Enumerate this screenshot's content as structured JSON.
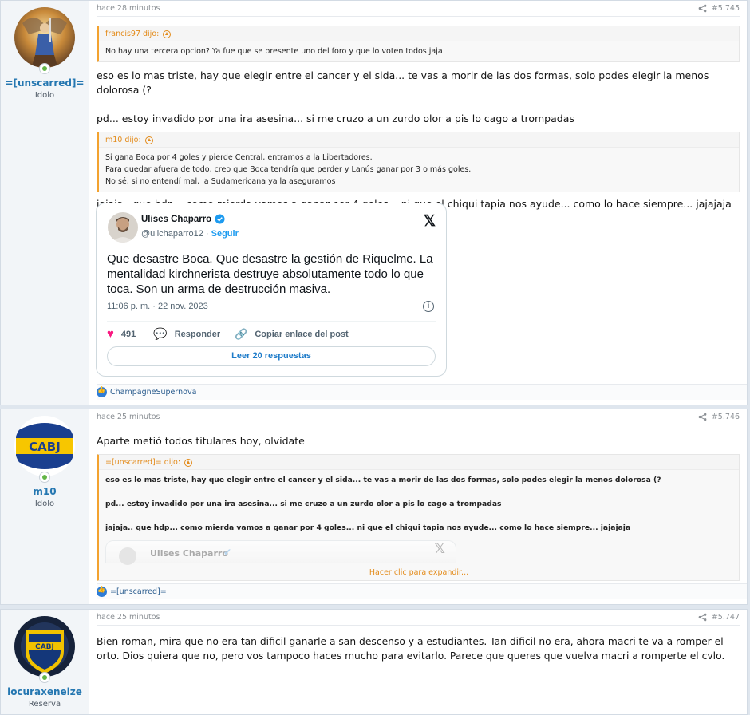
{
  "posts": [
    {
      "time": "hace 28 minutos",
      "number": "#5.745",
      "user": {
        "name": "=[unscarred]=",
        "title": "Idolo"
      },
      "quote1": {
        "author": "francis97 dijo:",
        "text": "No hay una tercera opcion? Ya fue que se presente uno del foro y que lo voten todos jaja"
      },
      "msg1": "eso es lo mas triste, hay que elegir entre el cancer y el sida... te vas a morir de las dos formas, solo podes elegir la menos dolorosa (?",
      "msg2": "pd... estoy invadido por una ira asesina... si me cruzo a un zurdo olor a pis lo cago a trompadas",
      "quote2": {
        "author": "m10 dijo:",
        "lines": [
          "Si gana Boca por 4 goles y pierde Central, entramos a la Libertadores.",
          "Para quedar afuera de todo, creo que Boca tendría que perder y Lanús ganar por 3 o más goles.",
          "No sé, si no entendí mal, la Sudamericana ya la aseguramos"
        ]
      },
      "msg3": "jajaja.. que hdp... como mierda vamos a ganar por 4 goles... ni que el chiqui tapia nos ayude... como lo hace siempre... jajajaja",
      "tweet": {
        "name": "Ulises Chaparro",
        "handle": "@ulichaparro12",
        "follow": "Seguir",
        "text": "Que desastre Boca. Que desastre la gestión de Riquelme. La mentalidad kirchnerista destruye absolutamente todo lo que toca. Son un arma de destrucción masiva.",
        "date": "11:06 p. m. · 22 nov. 2023",
        "likes": "491",
        "reply": "Responder",
        "copy": "Copiar enlace del post",
        "replies": "Leer 20 respuestas"
      },
      "reaction": "ChampagneSupernova"
    },
    {
      "time": "hace 25 minutos",
      "number": "#5.746",
      "user": {
        "name": "m10",
        "title": "Idolo"
      },
      "msg1": "Aparte metió todos titulares hoy, olvidate",
      "quote": {
        "author": "=[unscarred]= dijo:",
        "p1": "eso es lo mas triste, hay que elegir entre el cancer y el sida... te vas a morir de las dos formas, solo podes elegir la menos dolorosa (?",
        "p2": "pd... estoy invadido por una ira asesina... si me cruzo a un zurdo olor a pis lo cago a trompadas",
        "p3": "jajaja.. que hdp... como mierda vamos a ganar por 4 goles... ni que el chiqui tapia nos ayude... como lo hace siempre... jajajaja",
        "tweet_name": "Ulises Chaparro",
        "expand": "Hacer clic para expandir..."
      },
      "reaction": "=[unscarred]="
    },
    {
      "time": "hace 25 minutos",
      "number": "#5.747",
      "user": {
        "name": "locuraxeneize",
        "title": "Reserva"
      },
      "msg1": "Bien roman, mira que no era tan dificil ganarle a san descenso y a estudiantes. Tan dificil no era, ahora macri te va a romper el orto. Dios quiera que no, pero vos tampoco haces mucho para evitarlo. Parece que queres que vuelva macri a romperte el cvlo."
    }
  ],
  "icons": {
    "share": "share-icon",
    "like": "like-icon",
    "verified": "verified-badge-icon",
    "x": "x-logo-icon",
    "heart": "heart-icon",
    "info": "info-icon"
  }
}
